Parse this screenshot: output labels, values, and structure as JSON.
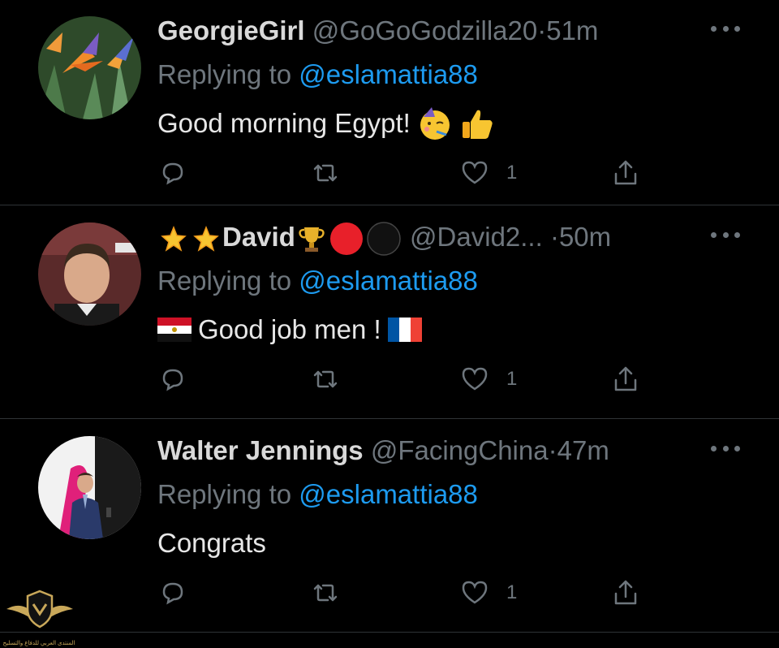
{
  "tweets": [
    {
      "name": "GeorgieGirl",
      "handle": "@GoGoGodzilla20",
      "dot": "·",
      "time": "51m",
      "replying_prefix": "Replying to",
      "replying_to": "@eslamattia88",
      "text": "Good morning Egypt!",
      "text_emojis": [
        "partying-face-emoji",
        "thumbs-up-emoji"
      ],
      "avatar": "bird-of-paradise-flower",
      "reply_count": "",
      "retweet_count": "",
      "like_count": "1"
    },
    {
      "name_prefix_emojis": [
        "glowing-star-emoji",
        "glowing-star-emoji"
      ],
      "name": "David",
      "name_suffix_emojis": [
        "trophy-emoji",
        "red-circle-emoji",
        "black-circle-emoji"
      ],
      "handle": "@David2...",
      "dot": "·",
      "time": "50m",
      "replying_prefix": "Replying to",
      "replying_to": "@eslamattia88",
      "text_prefix_emoji": "egypt-flag-emoji",
      "text": "Good job men !",
      "text_suffix_emoji": "france-flag-emoji",
      "avatar": "man-portrait",
      "reply_count": "",
      "retweet_count": "",
      "like_count": "1"
    },
    {
      "name": "Walter Jennings",
      "handle": "@FacingChina",
      "dot": "·",
      "time": "47m",
      "replying_prefix": "Replying to",
      "replying_to": "@eslamattia88",
      "text": "Congrats",
      "avatar": "speaker-on-stage",
      "reply_count": "",
      "retweet_count": "",
      "like_count": "1"
    }
  ],
  "watermark": {
    "text": "المنتدى العربي للدفاع والتسليح",
    "icon": "shield-eagle-logo"
  },
  "colors": {
    "background": "#000000",
    "name": "#d9d9d9",
    "muted": "#6e767d",
    "mention": "#1d9bf0",
    "divider": "#2f3336"
  }
}
